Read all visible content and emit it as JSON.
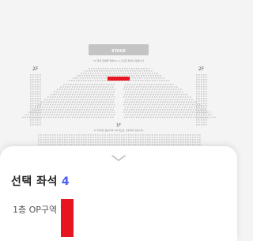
{
  "seat_map": {
    "stage_label": "STAGE",
    "stage_note": "1F 무대 전경을 위해 B~C 구간은 좌석이 없습니다",
    "floor_labels": {
      "left_2f": "2F",
      "right_2f": "2F",
      "center_1f": "1F"
    },
    "floor_1f_note": "1F 좌석은 일반석과 VIP석으로 구성되어 있습니다",
    "selected_block_color": "#e8141f",
    "seat_color": "#c9c9c9"
  },
  "selection_sheet": {
    "title": "선택 좌석",
    "count": "4",
    "selected_item": "1층 OP구역 1열",
    "accent_color": "#4a5cf0"
  }
}
